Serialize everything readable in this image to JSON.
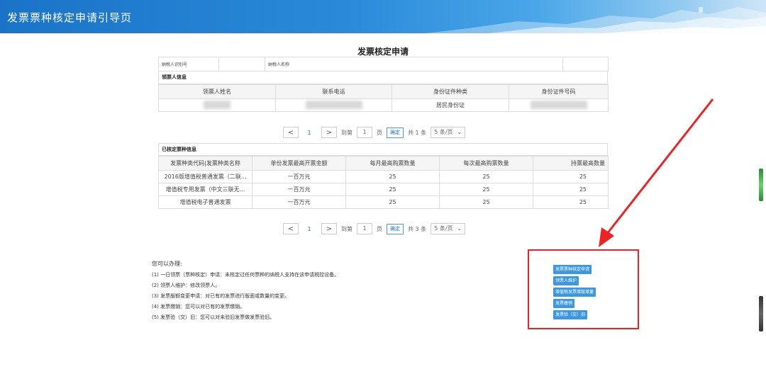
{
  "header": {
    "title": "发票票种核定申请引导页"
  },
  "doc": {
    "title": "发票核定申请",
    "taxpayer_id_label": "纳税人识别号",
    "taxpayer_name_label": "纳税人名称",
    "recipient_section": "领票人信息",
    "recipient_columns": [
      "领票人姓名",
      "联系电话",
      "身份证件种类",
      "身份证件号码"
    ],
    "recipient_row": {
      "id_type": "居民身份证"
    },
    "pager1": {
      "prev": "<",
      "page": "1",
      "next": ">",
      "goto": "到第",
      "input": "1",
      "page_unit": "页",
      "confirm": "确定",
      "total": "共 1 条",
      "per_page": "5 条/页"
    },
    "approved_section": "已核定票种信息",
    "approved_columns": [
      "发票种类代码|发票种类名称",
      "单份发票最高开票金额",
      "每月最高购票数量",
      "每次最高购票数量",
      "持票最高数量"
    ],
    "approved_rows": [
      [
        "2016版增值税普通发票（二联...",
        "一百万元",
        "25",
        "25",
        "25"
      ],
      [
        "增值税专用发票（中文三联无...",
        "一百万元",
        "25",
        "25",
        "25"
      ],
      [
        "增值税电子普通发票",
        "一百万元",
        "25",
        "25",
        "25"
      ]
    ],
    "pager2": {
      "prev": "<",
      "page": "1",
      "next": ">",
      "goto": "到第",
      "input": "1",
      "page_unit": "页",
      "confirm": "确定",
      "total": "共 3 条",
      "per_page": "5 条/页"
    }
  },
  "tips": {
    "title": "您可以办理:",
    "items": [
      "(1) 一日领票（票种核定）申请：未核定过任何票种的纳税人支持在该申请税控设备。",
      "(2) 领票人维护：修改领票人。",
      "(3) 发票版额变更申请：对已有的发票进行版面或数量的变更。",
      "(4) 发票缴销：您可以对已有的发票缴销。",
      "(5) 发票验（交）旧：您可以对未验旧发票做发票验旧。"
    ]
  },
  "actions": {
    "buttons": [
      "发票票种核定申请",
      "领票人维护",
      "增值税发票增版增量",
      "发票缴销",
      "发票验（交）旧"
    ]
  },
  "colors": {
    "accent": "#1a73c8",
    "highlight": "#ee2222",
    "button": "#3a97e0"
  }
}
